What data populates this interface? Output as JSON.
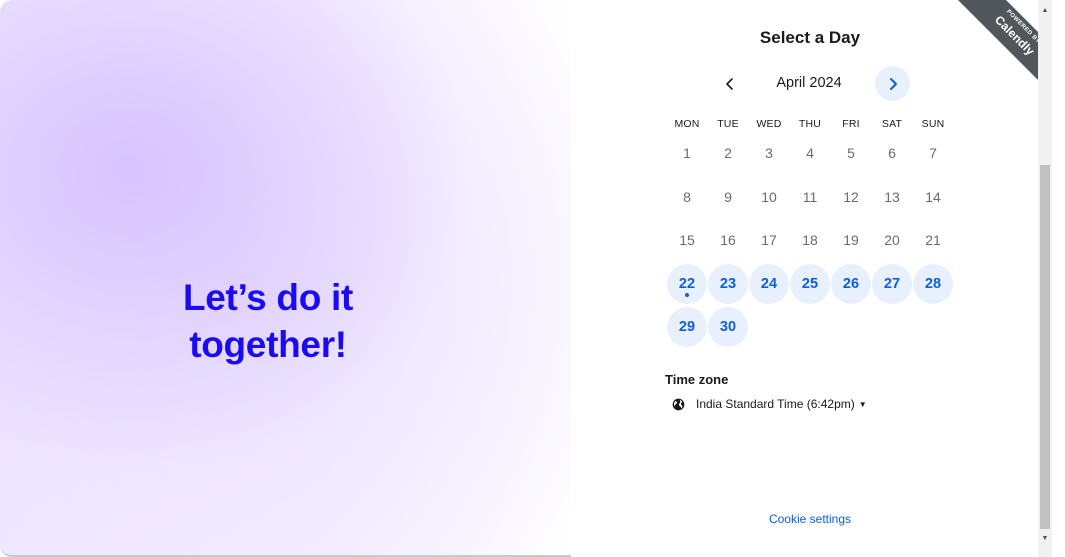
{
  "hero": {
    "title": "Let’s do it together!"
  },
  "scheduler": {
    "title": "Select a Day",
    "month_label": "April 2024",
    "prev_icon": "chevron-left-icon",
    "next_icon": "chevron-right-icon",
    "weekdays": [
      "MON",
      "TUE",
      "WED",
      "THU",
      "FRI",
      "SAT",
      "SUN"
    ],
    "days": [
      {
        "label": "1",
        "available": false
      },
      {
        "label": "2",
        "available": false
      },
      {
        "label": "3",
        "available": false
      },
      {
        "label": "4",
        "available": false
      },
      {
        "label": "5",
        "available": false
      },
      {
        "label": "6",
        "available": false
      },
      {
        "label": "7",
        "available": false
      },
      {
        "label": "8",
        "available": false
      },
      {
        "label": "9",
        "available": false
      },
      {
        "label": "10",
        "available": false
      },
      {
        "label": "11",
        "available": false
      },
      {
        "label": "12",
        "available": false
      },
      {
        "label": "13",
        "available": false
      },
      {
        "label": "14",
        "available": false
      },
      {
        "label": "15",
        "available": false
      },
      {
        "label": "16",
        "available": false
      },
      {
        "label": "17",
        "available": false
      },
      {
        "label": "18",
        "available": false
      },
      {
        "label": "19",
        "available": false
      },
      {
        "label": "20",
        "available": false
      },
      {
        "label": "21",
        "available": false
      },
      {
        "label": "22",
        "available": true,
        "today": true
      },
      {
        "label": "23",
        "available": true
      },
      {
        "label": "24",
        "available": true
      },
      {
        "label": "25",
        "available": true
      },
      {
        "label": "26",
        "available": true
      },
      {
        "label": "27",
        "available": true
      },
      {
        "label": "28",
        "available": true
      },
      {
        "label": "29",
        "available": true
      },
      {
        "label": "30",
        "available": true
      }
    ],
    "timezone": {
      "heading": "Time zone",
      "icon": "globe-icon",
      "value": "India Standard Time (6:42pm)",
      "caret_icon": "caret-down-icon"
    },
    "cookie_link": "Cookie settings"
  },
  "ribbon": {
    "small_text": "POWERED BY",
    "brand_text": "Calendly"
  },
  "colors": {
    "accent_blue": "#0b5fd8",
    "hero_title": "#1a0bf0",
    "available_bg": "#e8f0fd",
    "ribbon_bg": "#505659"
  }
}
